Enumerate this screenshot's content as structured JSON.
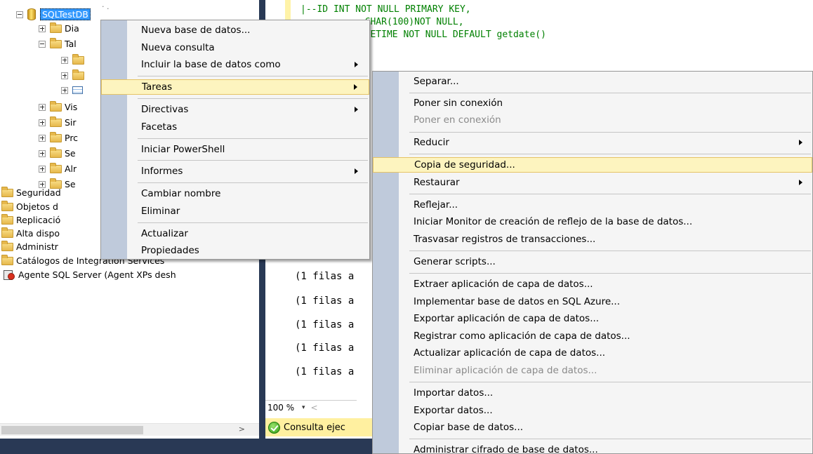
{
  "explorer": {
    "database": "SQLTestDB",
    "truncated_above": "· .",
    "db_children": [
      {
        "label": "Dia",
        "expander": "plus",
        "icon": "folder"
      },
      {
        "label": "Tal",
        "expander": "minus",
        "icon": "folder"
      },
      {
        "label": "",
        "expander": "plus",
        "icon": "folder",
        "indent": 2
      },
      {
        "label": "",
        "expander": "plus",
        "icon": "folder",
        "indent": 2
      },
      {
        "label": "",
        "expander": "plus",
        "icon": "table",
        "indent": 2
      },
      {
        "label": "Vis",
        "expander": "plus",
        "icon": "folder"
      },
      {
        "label": "Sir",
        "expander": "plus",
        "icon": "folder"
      },
      {
        "label": "Prc",
        "expander": "plus",
        "icon": "folder"
      },
      {
        "label": "Se",
        "expander": "plus",
        "icon": "folder"
      },
      {
        "label": "Alr",
        "expander": "plus",
        "icon": "folder"
      },
      {
        "label": "Se",
        "expander": "plus",
        "icon": "folder"
      }
    ],
    "server_nodes": [
      {
        "label": "Seguridad"
      },
      {
        "label": "Objetos d"
      },
      {
        "label": "Replicació"
      },
      {
        "label": "Alta dispo"
      },
      {
        "label": "Administr"
      },
      {
        "label": "Catálogos de Integration Services"
      }
    ],
    "agent_label": "Agente SQL Server (Agent XPs desh",
    "scroll_arrow": ">"
  },
  "editor": {
    "code_lines": [
      "|--ID INT NOT NULL PRIMARY KEY,",
      "  CHAR(100)NOT NULL,",
      "  TETIME NOT NULL DEFAULT getdate()"
    ],
    "result_lines": [
      "(1 filas a",
      "(1 filas a",
      "(1 filas a",
      "(1 filas a",
      "(1 filas a"
    ],
    "zoom": "100 %",
    "zoom_arrow": "▾",
    "scroll_left": "<",
    "status": "Consulta ejec"
  },
  "context_menu": {
    "items": [
      {
        "label": "Nueva base de datos...",
        "submenu": false
      },
      {
        "label": "Nueva consulta",
        "submenu": false
      },
      {
        "label": "Incluir la base de datos como",
        "submenu": true
      },
      {
        "label": "Tareas",
        "submenu": true,
        "highlighted": true
      },
      {
        "label": "Directivas",
        "submenu": true
      },
      {
        "label": "Facetas",
        "submenu": false
      },
      {
        "label": "Iniciar PowerShell",
        "submenu": false
      },
      {
        "label": "Informes",
        "submenu": true
      },
      {
        "label": "Cambiar nombre",
        "submenu": false
      },
      {
        "label": "Eliminar",
        "submenu": false
      },
      {
        "label": "Actualizar",
        "submenu": false
      },
      {
        "label": "Propiedades",
        "submenu": false
      }
    ]
  },
  "tasks_submenu": {
    "items": [
      {
        "label": "Separar...",
        "submenu": false
      },
      {
        "label": "Poner sin conexión",
        "submenu": false
      },
      {
        "label": "Poner en conexión",
        "submenu": false,
        "disabled": true
      },
      {
        "label": "Reducir",
        "submenu": true
      },
      {
        "label": "Copia de seguridad...",
        "submenu": false,
        "highlighted": true
      },
      {
        "label": "Restaurar",
        "submenu": true
      },
      {
        "label": "Reflejar...",
        "submenu": false
      },
      {
        "label": "Iniciar Monitor de creación de reflejo de la base de datos...",
        "submenu": false
      },
      {
        "label": "Trasvasar registros de transacciones...",
        "submenu": false
      },
      {
        "label": "Generar scripts...",
        "submenu": false
      },
      {
        "label": "Extraer aplicación de capa de datos...",
        "submenu": false
      },
      {
        "label": "Implementar base de datos en SQL Azure...",
        "submenu": false
      },
      {
        "label": "Exportar aplicación de capa de datos...",
        "submenu": false
      },
      {
        "label": "Registrar como aplicación de capa de datos...",
        "submenu": false
      },
      {
        "label": "Actualizar aplicación de capa de datos...",
        "submenu": false
      },
      {
        "label": "Eliminar aplicación de capa de datos...",
        "submenu": false,
        "disabled": true
      },
      {
        "label": "Importar datos...",
        "submenu": false
      },
      {
        "label": "Exportar datos...",
        "submenu": false
      },
      {
        "label": "Copiar base de datos...",
        "submenu": false
      },
      {
        "label": "Administrar cifrado de base de datos...",
        "submenu": false
      }
    ]
  }
}
